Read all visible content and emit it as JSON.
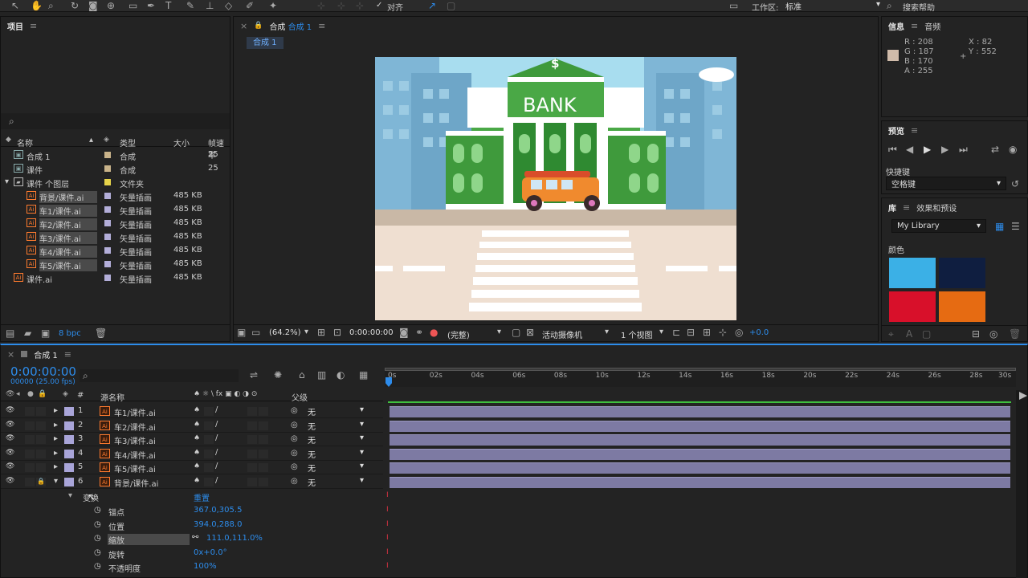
{
  "toolbar": {
    "align_label": "对齐",
    "workspace_label": "工作区:",
    "workspace_value": "标准",
    "search_placeholder": "搜索帮助"
  },
  "project": {
    "title": "项目",
    "search_placeholder": "",
    "columns": {
      "name": "名称",
      "type": "类型",
      "size": "大小",
      "fps": "帧速率"
    },
    "items": [
      {
        "name": "合成 1",
        "type": "合成",
        "size": "",
        "fps": "25",
        "indent": 0,
        "color": "#c9b38a",
        "kind": "comp"
      },
      {
        "name": "课件",
        "type": "合成",
        "size": "",
        "fps": "25",
        "indent": 0,
        "color": "#c9b38a",
        "kind": "comp"
      },
      {
        "name": "课件 个图层",
        "type": "文件夹",
        "size": "",
        "fps": "",
        "indent": 0,
        "color": "#e6d34a",
        "kind": "folder"
      },
      {
        "name": "背景/课件.ai",
        "type": "矢量插画",
        "size": "485 KB",
        "fps": "",
        "indent": 1,
        "color": "#b3aed9",
        "kind": "ai"
      },
      {
        "name": "车1/课件.ai",
        "type": "矢量插画",
        "size": "485 KB",
        "fps": "",
        "indent": 1,
        "color": "#b3aed9",
        "kind": "ai"
      },
      {
        "name": "车2/课件.ai",
        "type": "矢量插画",
        "size": "485 KB",
        "fps": "",
        "indent": 1,
        "color": "#b3aed9",
        "kind": "ai"
      },
      {
        "name": "车3/课件.ai",
        "type": "矢量插画",
        "size": "485 KB",
        "fps": "",
        "indent": 1,
        "color": "#b3aed9",
        "kind": "ai"
      },
      {
        "name": "车4/课件.ai",
        "type": "矢量插画",
        "size": "485 KB",
        "fps": "",
        "indent": 1,
        "color": "#b3aed9",
        "kind": "ai"
      },
      {
        "name": "车5/课件.ai",
        "type": "矢量插画",
        "size": "485 KB",
        "fps": "",
        "indent": 1,
        "color": "#b3aed9",
        "kind": "ai"
      },
      {
        "name": "课件.ai",
        "type": "矢量插画",
        "size": "485 KB",
        "fps": "",
        "indent": 0,
        "color": "#b3aed9",
        "kind": "ai"
      }
    ],
    "bpc": "8 bpc"
  },
  "composition": {
    "panel_label": "合成",
    "comp_name": "合成 1",
    "tab": "合成 1",
    "zoom": "(64.2%)",
    "timecode": "0:00:00:00",
    "quality": "(完整)",
    "camera": "活动摄像机",
    "views": "1 个视图",
    "exposure": "+0.0",
    "bank_text": "BANK",
    "dollar": "$"
  },
  "info": {
    "tab1": "信息",
    "tab2": "音频",
    "r": "R : 208",
    "g": "G : 187",
    "b": "B : 170",
    "a": "A : 255",
    "x": "X : 82",
    "y": "Y : 552",
    "swatch": "#d0bbaa"
  },
  "preview": {
    "title": "预览",
    "shortcut_label": "快捷键",
    "shortcut_value": "空格键"
  },
  "library": {
    "tab1": "库",
    "tab2": "效果和预设",
    "library_name": "My Library",
    "colors_label": "颜色",
    "swatches": [
      "#3bb0e6",
      "#0f1e40",
      "#d8102a",
      "#e66b12"
    ]
  },
  "timeline": {
    "comp_name": "合成 1",
    "timecode": "0:00:00:00",
    "fps": "00000 (25.00 fps)",
    "col_name": "源名称",
    "col_parent": "父级",
    "ticks": [
      "0s",
      "02s",
      "04s",
      "06s",
      "08s",
      "10s",
      "12s",
      "14s",
      "16s",
      "18s",
      "20s",
      "22s",
      "24s",
      "26s",
      "28s",
      "30s"
    ],
    "layers": [
      {
        "num": "1",
        "name": "车1/课件.ai",
        "parent": "无",
        "locked": false,
        "expanded": false
      },
      {
        "num": "2",
        "name": "车2/课件.ai",
        "parent": "无",
        "locked": false,
        "expanded": false
      },
      {
        "num": "3",
        "name": "车3/课件.ai",
        "parent": "无",
        "locked": false,
        "expanded": false
      },
      {
        "num": "4",
        "name": "车4/课件.ai",
        "parent": "无",
        "locked": false,
        "expanded": false
      },
      {
        "num": "5",
        "name": "车5/课件.ai",
        "parent": "无",
        "locked": false,
        "expanded": false
      },
      {
        "num": "6",
        "name": "背景/课件.ai",
        "parent": "无",
        "locked": true,
        "expanded": true
      }
    ],
    "transform": {
      "label": "变换",
      "reset": "重置",
      "props": [
        {
          "name": "锚点",
          "value": "367.0,305.5"
        },
        {
          "name": "位置",
          "value": "394.0,288.0"
        },
        {
          "name": "缩放",
          "value": "111.0,111.0%"
        },
        {
          "name": "旋转",
          "value": "0x+0.0°"
        },
        {
          "name": "不透明度",
          "value": "100%"
        }
      ]
    }
  }
}
